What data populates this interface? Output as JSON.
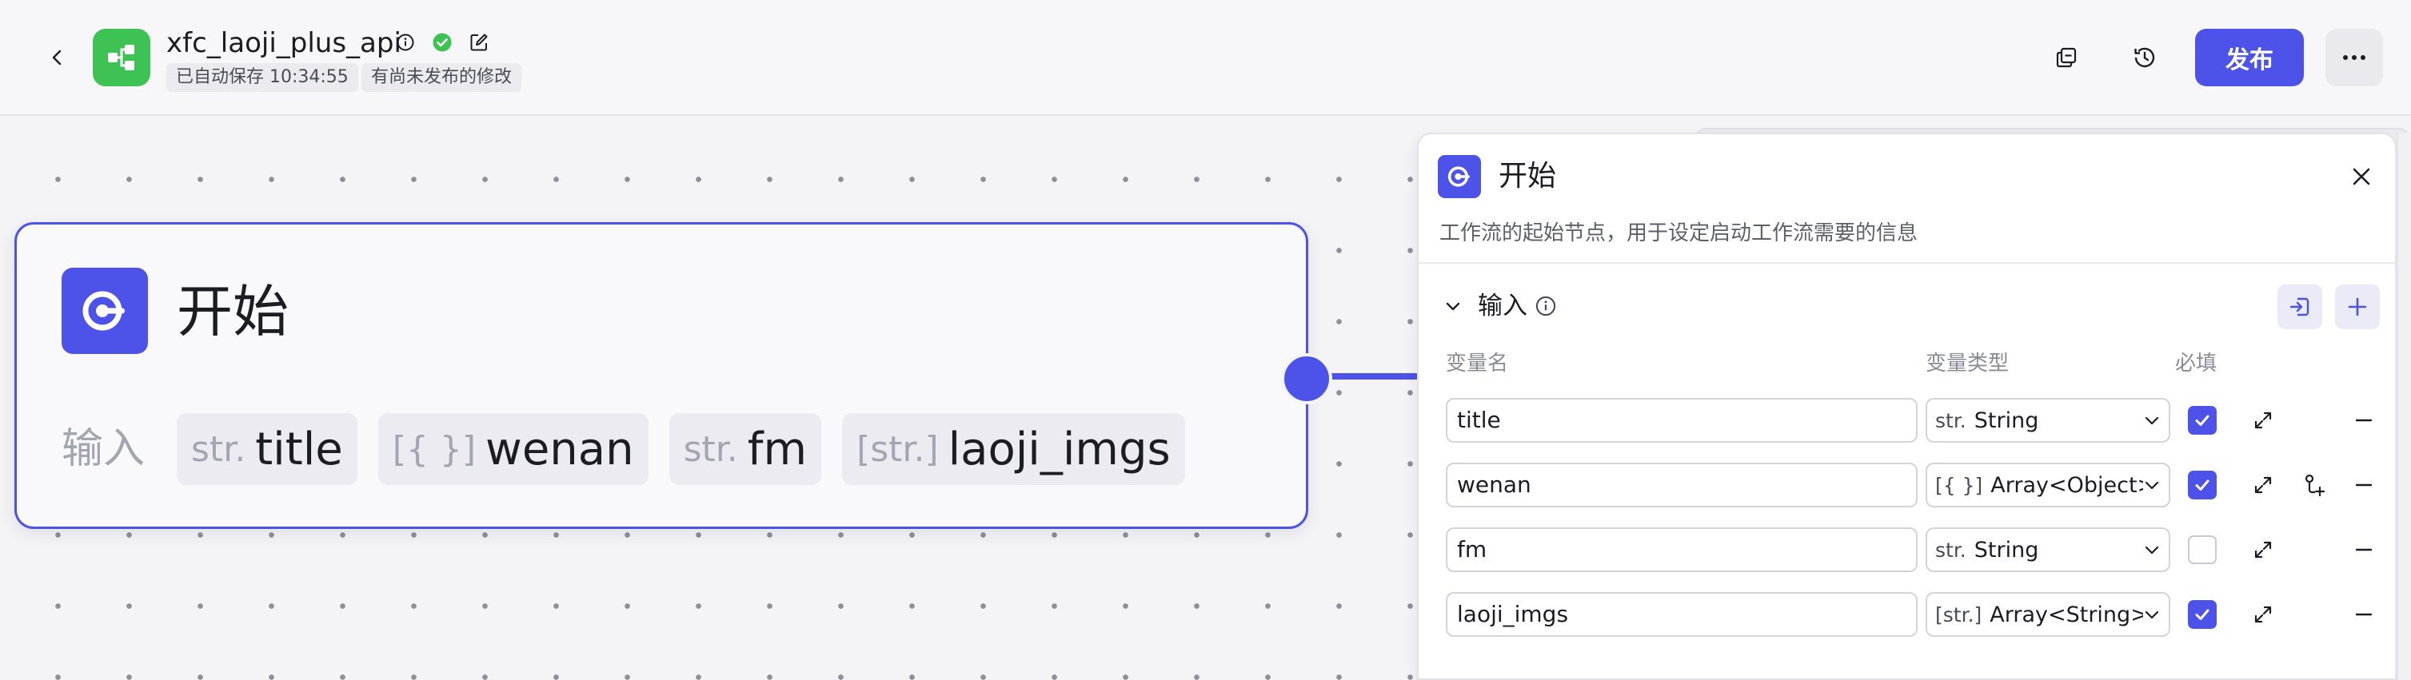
{
  "header": {
    "app_title": "xfc_laoji_plus_api",
    "autosave_text": "已自动保存 10:34:55",
    "unpublished_text": "有尚未发布的修改",
    "publish_label": "发布",
    "icons": [
      "back-arrow-icon",
      "app-logo-icon",
      "info-icon",
      "verified-check-icon",
      "edit-icon",
      "copy-icon",
      "history-icon",
      "more-icon"
    ]
  },
  "node": {
    "title": "开始",
    "input_label": "输入",
    "variables": [
      {
        "type_icon": "str.",
        "name": "title"
      },
      {
        "type_icon": "[{ }]",
        "name": "wenan"
      },
      {
        "type_icon": "str.",
        "name": "fm"
      },
      {
        "type_icon": "[str.]",
        "name": "laoji_imgs"
      }
    ]
  },
  "panel": {
    "title": "开始",
    "description": "工作流的起始节点，用于设定启动工作流需要的信息",
    "section_title": "输入",
    "columns": {
      "name": "变量名",
      "type": "变量类型",
      "required": "必填"
    },
    "rows": [
      {
        "name": "title",
        "type_icon": "str.",
        "type": "String",
        "required": true
      },
      {
        "name": "wenan",
        "type_icon": "[{ }]",
        "type": "Array<Object>",
        "required": true
      },
      {
        "name": "fm",
        "type_icon": "str.",
        "type": "String",
        "required": false
      },
      {
        "name": "laoji_imgs",
        "type_icon": "[str.]",
        "type": "Array<String>",
        "required": true
      }
    ]
  },
  "colors": {
    "accent": "#4d53e8",
    "logo_green": "#3ec254",
    "canvas_dot": "#8e8f99"
  }
}
